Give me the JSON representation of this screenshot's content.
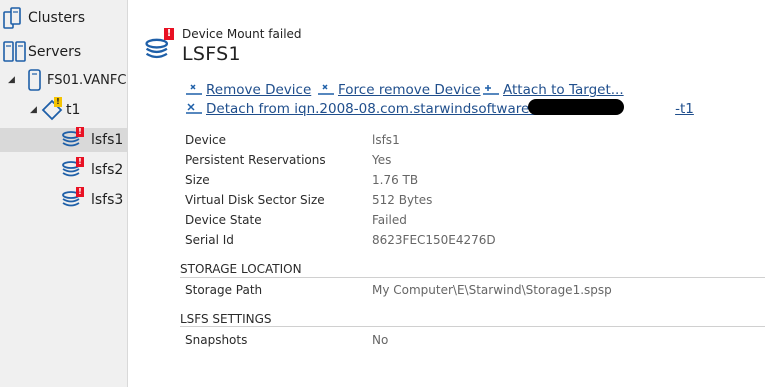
{
  "tree": {
    "clusters": "Clusters",
    "servers": "Servers",
    "server_name": "FS01.VANFC",
    "target": "t1",
    "devices": [
      "lsfs1",
      "lsfs2",
      "lsfs3"
    ]
  },
  "header": {
    "status": "Device Mount failed",
    "title": "LSFS1"
  },
  "actions": {
    "remove": "Remove Device",
    "force_remove": "Force remove Device",
    "attach": "Attach to Target...",
    "detach_prefix": "Detach from iqn.2008-08.com.starwindsoftware:fs01.",
    "detach_suffix": "-t1"
  },
  "properties": [
    {
      "key": "Device",
      "value": "lsfs1"
    },
    {
      "key": "Persistent Reservations",
      "value": "Yes"
    },
    {
      "key": "Size",
      "value": "1.76 TB"
    },
    {
      "key": "Virtual Disk Sector Size",
      "value": "512 Bytes"
    },
    {
      "key": "Device State",
      "value": "Failed"
    },
    {
      "key": "Serial Id",
      "value": "8623FEC150E4276D"
    }
  ],
  "storage": {
    "heading": "STORAGE LOCATION",
    "key": "Storage Path",
    "value": "My Computer\\E\\Starwind\\Storage1.spsp"
  },
  "lsfs_settings": {
    "heading": "LSFS SETTINGS",
    "key": "Snapshots",
    "value": "No"
  },
  "colors": {
    "link": "#1f4e8c",
    "icon_blue": "#1e5fa8",
    "error_badge": "#e81123",
    "warning_badge": "#f5c400",
    "selection": "#d9d9d9"
  }
}
